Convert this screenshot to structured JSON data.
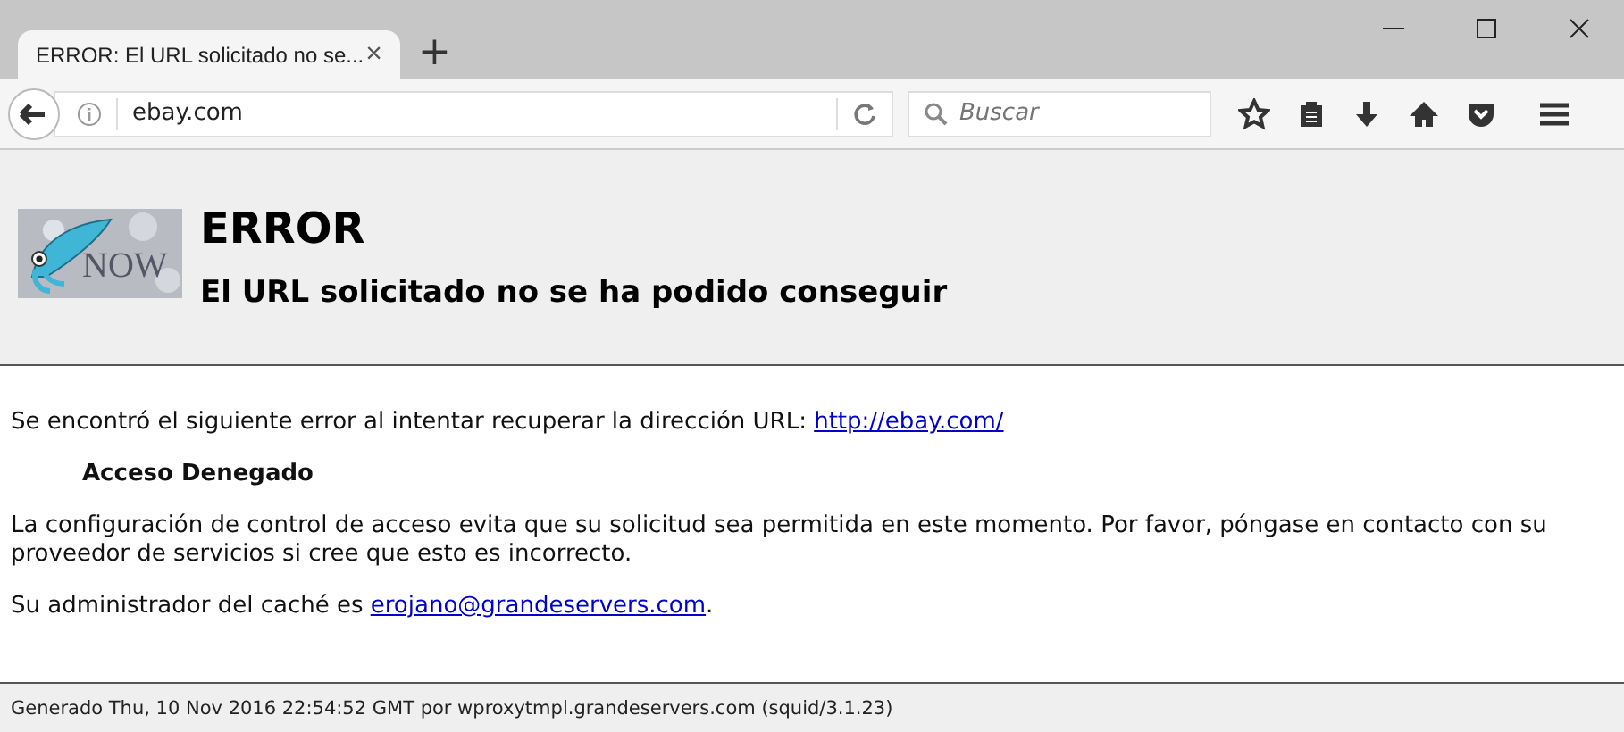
{
  "browser": {
    "tabs": [
      {
        "title": "ERROR: El URL solicitado no se...",
        "selected": true
      }
    ],
    "close_tab": "×",
    "new_tab": "+",
    "address": "ebay.com",
    "search": {
      "placeholder": "Buscar"
    }
  },
  "header": {
    "logo_text": "NOW",
    "title": "ERROR",
    "subtitle": "El URL solicitado no se ha podido conseguir"
  },
  "body": {
    "intro": "Se encontró el siguiente error al intentar recuperar la dirección URL:",
    "intro_link": "http://ebay.com/",
    "error_name": "Acceso Denegado",
    "description": "La configuración de control de acceso evita que su solicitud sea permitida en este momento. Por favor, póngase en contacto con su proveedor de servicios si cree que esto es incorrecto.",
    "admin": "Su administrador del caché es",
    "admin_link": "erojano@grandeservers.com",
    "admin_end": "."
  },
  "footer": "Generado Thu, 10 Nov 2016 22:54:52 GMT por wproxytmpl.grandeservers.com (squid/3.1.23)"
}
